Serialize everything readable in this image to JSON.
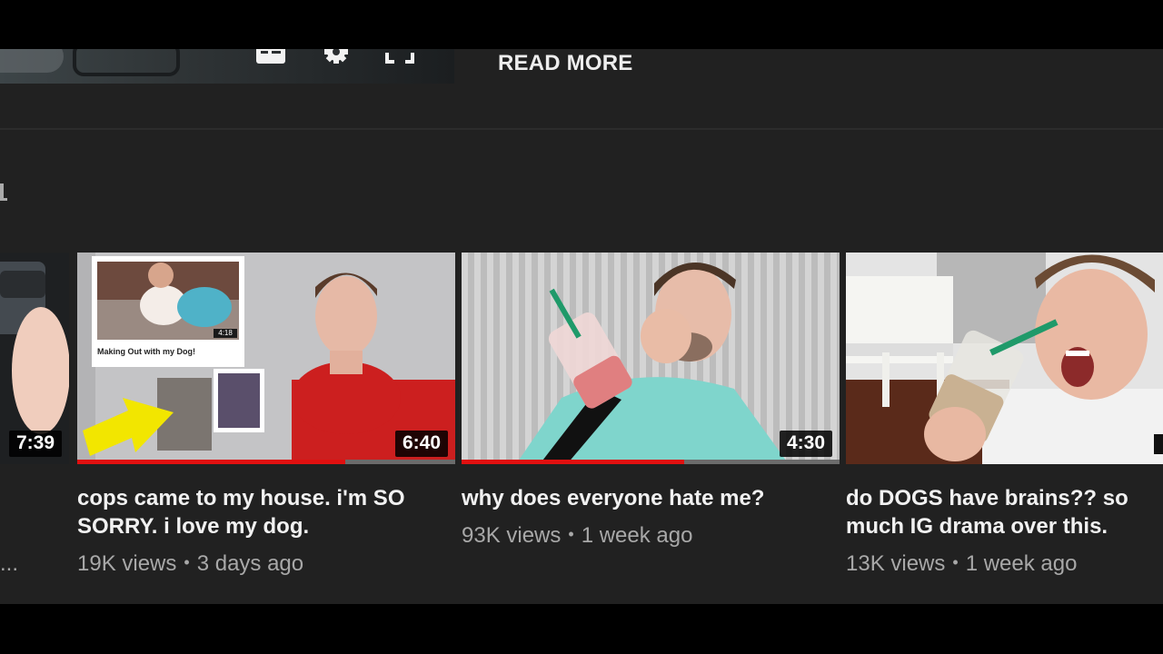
{
  "player": {
    "controls": [
      "captions-icon",
      "gear-icon",
      "fullscreen-icon"
    ]
  },
  "description": {
    "read_more_label": "READ MORE"
  },
  "videos": [
    {
      "duration": "7:39",
      "title": "",
      "meta_tail": "...",
      "progress": 0
    },
    {
      "duration": "6:40",
      "title": "cops came to my house. i'm SO SORRY. i love my dog.",
      "views": "19K views",
      "age": "3 days ago",
      "inset_caption": "Making Out with my Dog!",
      "inset_duration": "4:18",
      "progress": 0.71
    },
    {
      "duration": "4:30",
      "title": "why does everyone hate me?",
      "views": "93K views",
      "age": "1 week ago",
      "progress": 0.59
    },
    {
      "duration": "",
      "title": "do DOGS have brains?? so much IG drama over this.",
      "views": "13K views",
      "age": "1 week ago",
      "progress": 0
    }
  ],
  "colors": {
    "background": "#212121",
    "progress_red": "#e01010",
    "title_text": "#f1f1f1",
    "meta_text": "#a8a8a8"
  }
}
